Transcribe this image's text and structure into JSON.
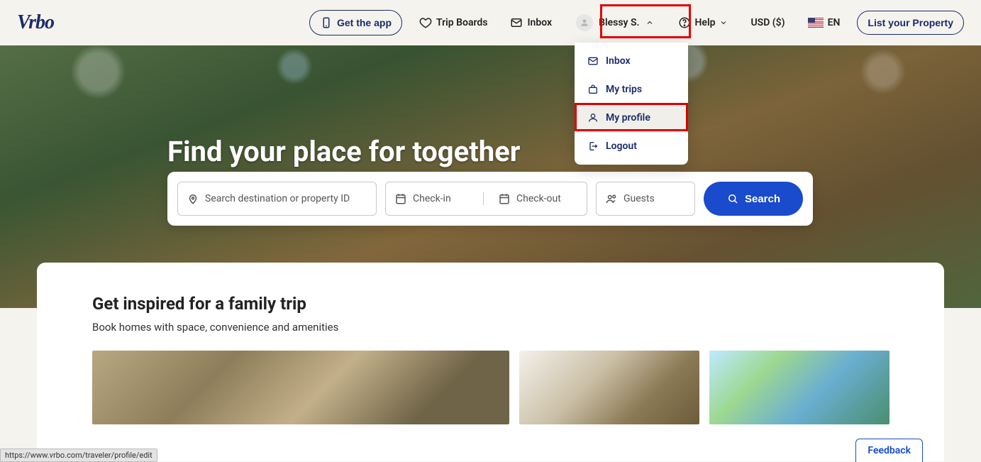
{
  "header": {
    "logo_text": "Vrbo",
    "get_app_label": "Get the app",
    "trip_boards_label": "Trip Boards",
    "inbox_label": "Inbox",
    "user_name": "Blessy S.",
    "help_label": "Help",
    "currency_label": "USD ($)",
    "language_label": "EN",
    "list_property_label": "List your Property"
  },
  "user_menu": {
    "items": [
      {
        "icon": "envelope",
        "label": "Inbox"
      },
      {
        "icon": "suitcase",
        "label": "My trips"
      },
      {
        "icon": "person",
        "label": "My profile"
      },
      {
        "icon": "logout",
        "label": "Logout"
      }
    ],
    "hover_index": 2
  },
  "hero": {
    "headline": "Find your place for together",
    "search": {
      "destination_placeholder": "Search destination or property ID",
      "checkin_placeholder": "Check-in",
      "checkout_placeholder": "Check-out",
      "guests_placeholder": "Guests",
      "button_label": "Search"
    }
  },
  "inspire": {
    "title": "Get inspired for a family trip",
    "subtitle": "Book homes with space, convenience and amenities"
  },
  "feedback_label": "Feedback",
  "status_url": "https://www.vrbo.com/traveler/profile/edit"
}
